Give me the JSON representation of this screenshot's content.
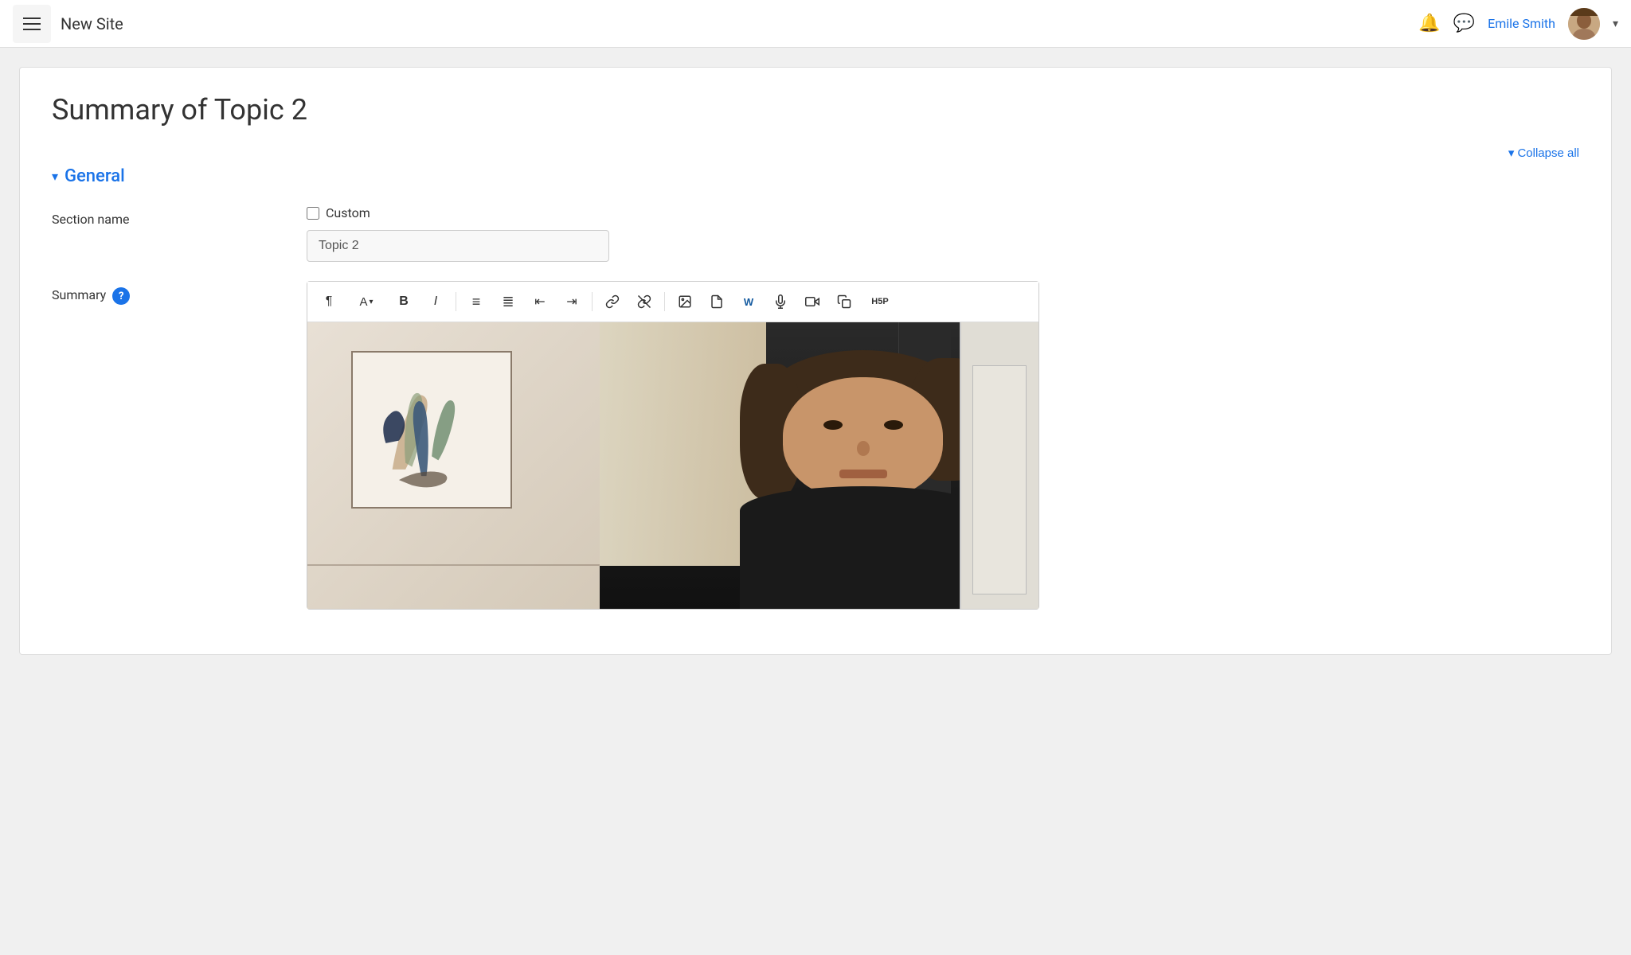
{
  "header": {
    "menu_label": "Menu",
    "site_title": "New Site",
    "notification_icon": "🔔",
    "chat_icon": "💬",
    "user_name": "Emile Smith",
    "dropdown_arrow": "▾"
  },
  "page": {
    "title": "Summary of Topic 2"
  },
  "collapse_all": {
    "label": "Collapse all"
  },
  "section": {
    "title": "General"
  },
  "form": {
    "section_name_label": "Section name",
    "custom_checkbox_label": "Custom",
    "topic_value": "Topic 2",
    "summary_label": "Summary"
  },
  "toolbar": {
    "buttons": [
      {
        "name": "paragraph",
        "symbol": "¶"
      },
      {
        "name": "font-size",
        "symbol": "A"
      },
      {
        "name": "bold",
        "symbol": "B"
      },
      {
        "name": "italic",
        "symbol": "I"
      },
      {
        "name": "unordered-list",
        "symbol": "≡"
      },
      {
        "name": "ordered-list",
        "symbol": "≣"
      },
      {
        "name": "indent-decrease",
        "symbol": "⇤"
      },
      {
        "name": "indent-increase",
        "symbol": "⇥"
      },
      {
        "name": "link",
        "symbol": "🔗"
      },
      {
        "name": "unlink",
        "symbol": "⚡"
      },
      {
        "name": "image",
        "symbol": "🖼"
      },
      {
        "name": "file",
        "symbol": "📄"
      },
      {
        "name": "word",
        "symbol": "W"
      },
      {
        "name": "audio",
        "symbol": "🎤"
      },
      {
        "name": "video",
        "symbol": "🎥"
      },
      {
        "name": "copy",
        "symbol": "⧉"
      },
      {
        "name": "h5p",
        "symbol": "H5P"
      }
    ]
  }
}
